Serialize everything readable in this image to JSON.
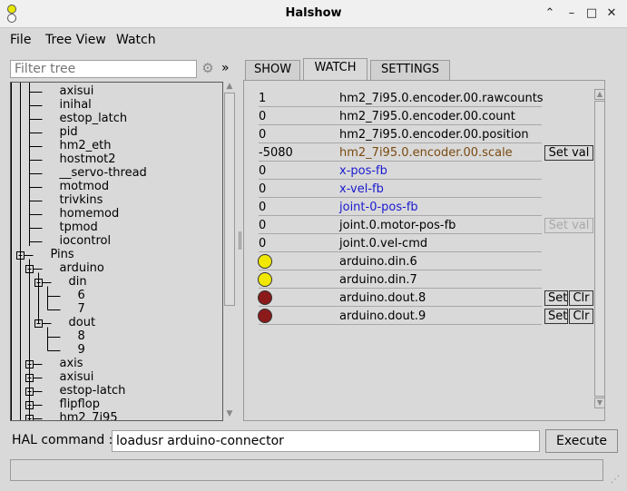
{
  "window": {
    "title": "Halshow"
  },
  "window_controls": {
    "minimize": "⌃",
    "minimize2": "–",
    "maximize": "□",
    "close": "✕"
  },
  "menu": [
    "File",
    "Tree View",
    "Watch"
  ],
  "filter": {
    "placeholder": "Filter tree",
    "expand_label": "»"
  },
  "tree": [
    {
      "label": "axisui",
      "level": 2
    },
    {
      "label": "inihal",
      "level": 2
    },
    {
      "label": "estop_latch",
      "level": 2
    },
    {
      "label": "pid",
      "level": 2
    },
    {
      "label": "hm2_eth",
      "level": 2
    },
    {
      "label": "hostmot2",
      "level": 2
    },
    {
      "label": "__servo-thread",
      "level": 2
    },
    {
      "label": "motmod",
      "level": 2
    },
    {
      "label": "trivkins",
      "level": 2
    },
    {
      "label": "homemod",
      "level": 2
    },
    {
      "label": "tpmod",
      "level": 2
    },
    {
      "label": "iocontrol",
      "level": 2
    },
    {
      "label": "Pins",
      "level": 1,
      "box": "minus"
    },
    {
      "label": "arduino",
      "level": 2,
      "box": "minus"
    },
    {
      "label": "din",
      "level": 3,
      "box": "minus"
    },
    {
      "label": "6",
      "level": 4
    },
    {
      "label": "7",
      "level": 4
    },
    {
      "label": "dout",
      "level": 3,
      "box": "minus"
    },
    {
      "label": "8",
      "level": 4
    },
    {
      "label": "9",
      "level": 4
    },
    {
      "label": "axis",
      "level": 2,
      "box": "plus"
    },
    {
      "label": "axisui",
      "level": 2,
      "box": "plus"
    },
    {
      "label": "estop-latch",
      "level": 2,
      "box": "plus"
    },
    {
      "label": "flipflop",
      "level": 2,
      "box": "plus"
    },
    {
      "label": "hm2_7i95",
      "level": 2,
      "box": "plus"
    }
  ],
  "tabs": [
    {
      "label": "SHOW",
      "active": false
    },
    {
      "label": "WATCH",
      "active": true
    },
    {
      "label": "SETTINGS",
      "active": false
    }
  ],
  "watch": [
    {
      "kind": "value",
      "value": "1",
      "name": "hm2_7i95.0.encoder.00.rawcounts",
      "color": "#000000",
      "buttons": []
    },
    {
      "kind": "value",
      "value": "0",
      "name": "hm2_7i95.0.encoder.00.count",
      "color": "#000000",
      "buttons": []
    },
    {
      "kind": "value",
      "value": "0",
      "name": "hm2_7i95.0.encoder.00.position",
      "color": "#000000",
      "buttons": []
    },
    {
      "kind": "value",
      "value": "-5080",
      "name": "hm2_7i95.0.encoder.00.scale",
      "color": "#7a4a10",
      "buttons": [
        {
          "label": "Set val",
          "disabled": false
        }
      ]
    },
    {
      "kind": "value",
      "value": "0",
      "name": "x-pos-fb",
      "color": "#1a1ad0",
      "buttons": []
    },
    {
      "kind": "value",
      "value": "0",
      "name": "x-vel-fb",
      "color": "#1a1ad0",
      "buttons": []
    },
    {
      "kind": "value",
      "value": "0",
      "name": "joint-0-pos-fb",
      "color": "#1a1ad0",
      "buttons": []
    },
    {
      "kind": "value",
      "value": "0",
      "name": "joint.0.motor-pos-fb",
      "color": "#000000",
      "buttons": [
        {
          "label": "Set val",
          "disabled": true
        }
      ]
    },
    {
      "kind": "value",
      "value": "0",
      "name": "joint.0.vel-cmd",
      "color": "#000000",
      "buttons": []
    },
    {
      "kind": "led",
      "led_color": "#f0e800",
      "name": "arduino.din.6",
      "color": "#000000",
      "buttons": []
    },
    {
      "kind": "led",
      "led_color": "#f0e800",
      "name": "arduino.din.7",
      "color": "#000000",
      "buttons": []
    },
    {
      "kind": "led",
      "led_color": "#8b1a1a",
      "name": "arduino.dout.8",
      "color": "#000000",
      "buttons": [
        {
          "label": "Set",
          "disabled": false
        },
        {
          "label": "Clr",
          "disabled": false
        }
      ]
    },
    {
      "kind": "led",
      "led_color": "#8b1a1a",
      "name": "arduino.dout.9",
      "color": "#000000",
      "buttons": [
        {
          "label": "Set",
          "disabled": false
        },
        {
          "label": "Clr",
          "disabled": false
        }
      ]
    }
  ],
  "command": {
    "label": "HAL command :",
    "value": "loadusr arduino-connector",
    "execute_label": "Execute"
  },
  "status": {
    "text": ""
  }
}
